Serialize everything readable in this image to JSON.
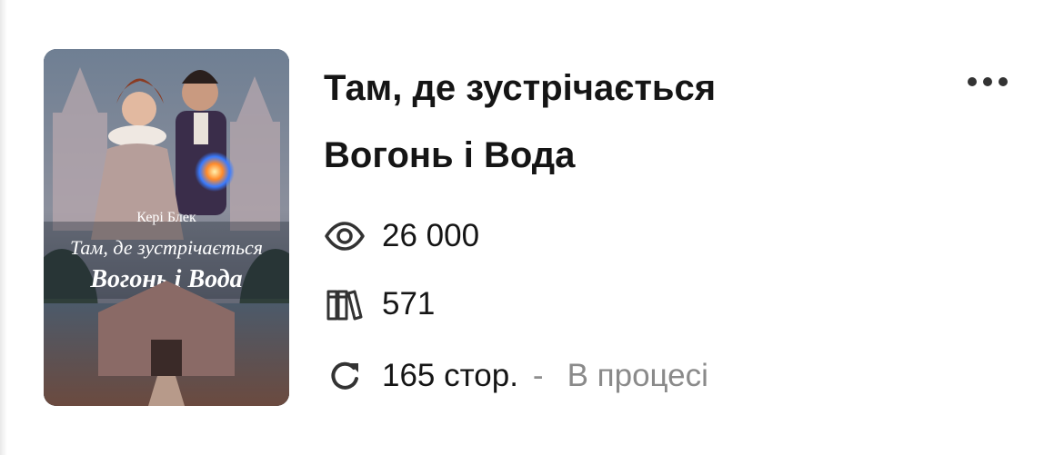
{
  "book": {
    "title_line1": "Там, де зустрічається",
    "title_line2": "Вогонь і Вода",
    "cover": {
      "author": "Кері Блек",
      "title_line1": "Там, де зустрічається",
      "title_line2": "Вогонь і Вода"
    }
  },
  "stats": {
    "views": "26 000",
    "library": "571",
    "pages": "165 стор.",
    "separator": "-",
    "status": "В процесі"
  },
  "icons": {
    "views": "eye-icon",
    "library": "books-icon",
    "pages": "refresh-icon",
    "menu": "more-horizontal-icon"
  },
  "colors": {
    "title": "#151515",
    "status": "#8a8a8a",
    "icon": "#333333"
  }
}
